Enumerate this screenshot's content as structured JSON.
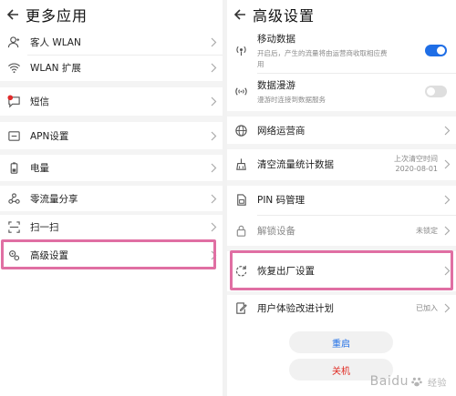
{
  "left": {
    "title": "更多应用",
    "items": [
      {
        "label": "客人 WLAN",
        "icon": "guest-user-icon"
      },
      {
        "label": "WLAN 扩展",
        "icon": "wifi-icon"
      },
      {
        "label": "短信",
        "icon": "message-icon"
      },
      {
        "label": "APN设置",
        "icon": "apn-icon"
      },
      {
        "label": "电量",
        "icon": "battery-icon"
      },
      {
        "label": "零流量分享",
        "icon": "share-icon"
      },
      {
        "label": "扫一扫",
        "icon": "scan-icon"
      },
      {
        "label": "高级设置",
        "icon": "advanced-settings-icon"
      }
    ]
  },
  "right": {
    "title": "高级设置",
    "mobile_data": {
      "label": "移动数据",
      "desc1": "开启后，产生的流量将由运营商收取相应费",
      "desc2": "用",
      "on": true
    },
    "roaming": {
      "label": "数据漫游",
      "desc": "漫游时连接到数据服务",
      "on": false
    },
    "carrier": {
      "label": "网络运营商"
    },
    "clear_stats": {
      "label": "清空流量统计数据",
      "value1": "上次清空时间",
      "value2": "2020-08-01"
    },
    "pin": {
      "label": "PIN 码管理"
    },
    "unlock": {
      "label": "解锁设备",
      "value": "未锁定"
    },
    "factory_reset": {
      "label": "恢复出厂设置"
    },
    "ux_plan": {
      "label": "用户体验改进计划",
      "value": "已加入"
    },
    "restart": "重启",
    "shutdown": "关机"
  },
  "colors": {
    "accent": "#1f6ee6",
    "highlight": "#e06fa3",
    "danger": "#e0281f"
  },
  "watermark": {
    "brand": "Baidu",
    "suffix": "经验"
  }
}
